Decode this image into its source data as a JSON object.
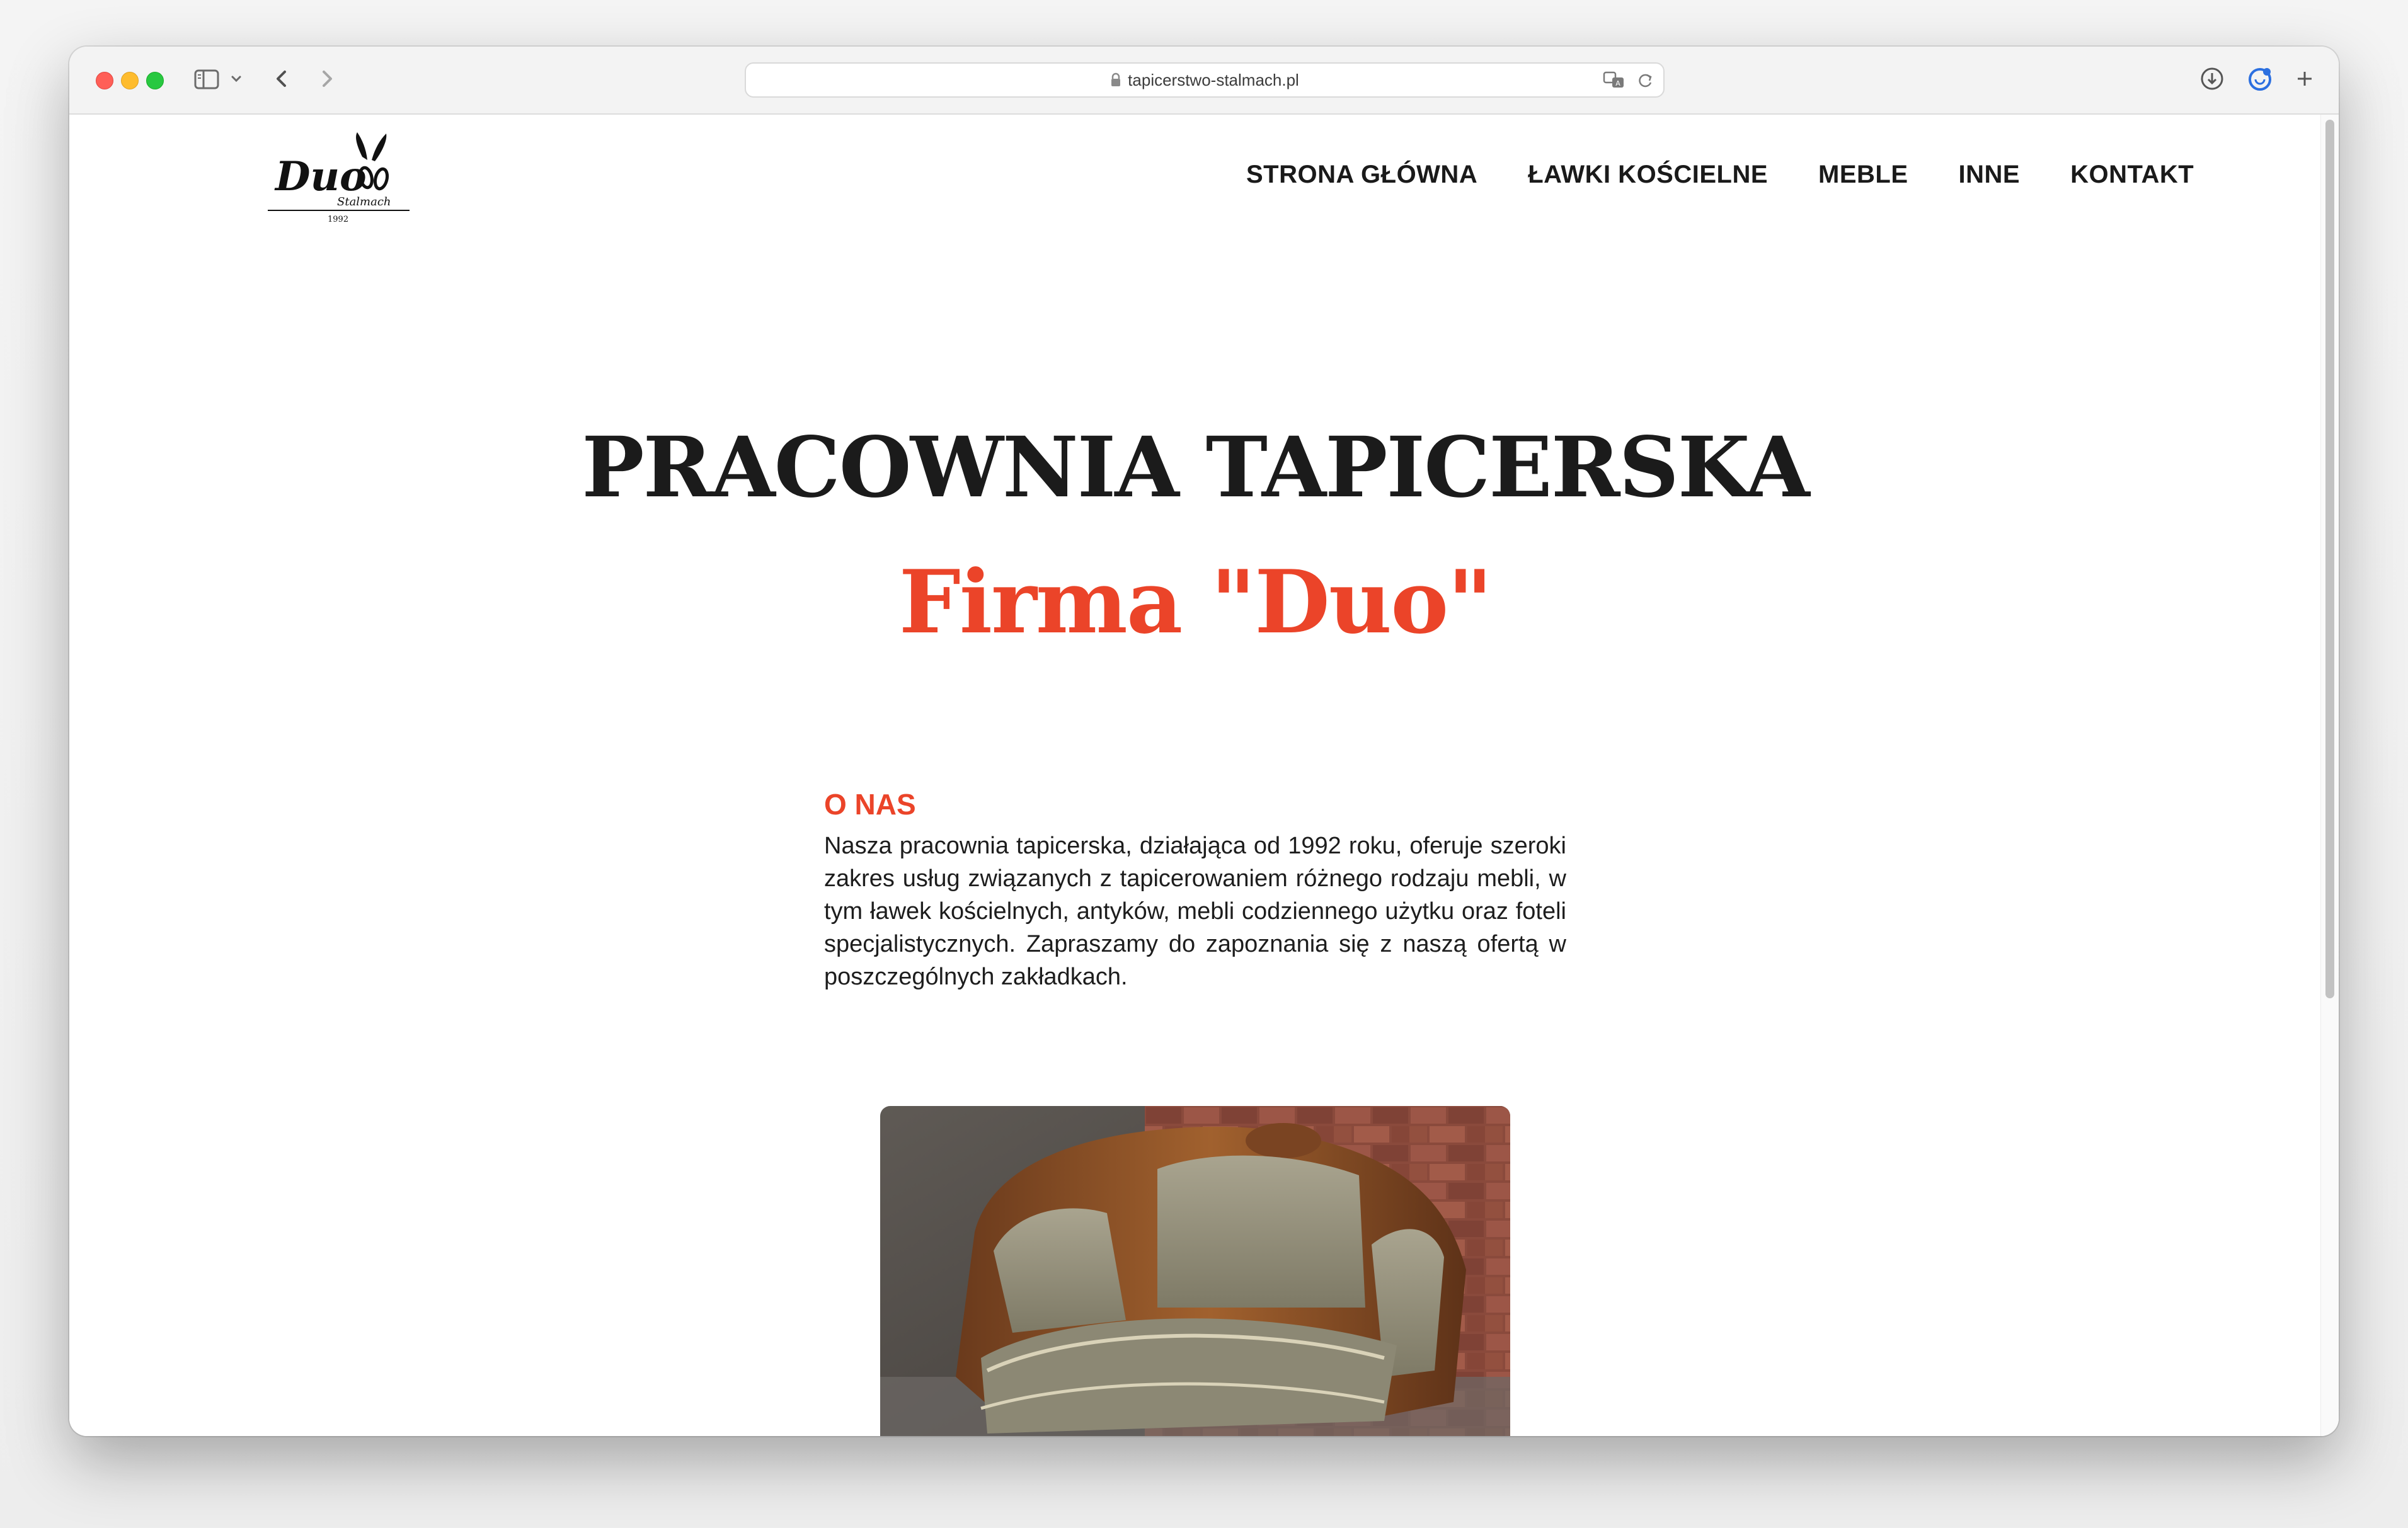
{
  "browser": {
    "url": "tapicerstwo-stalmach.pl"
  },
  "site": {
    "logo": {
      "wordmark": "Duo",
      "subtitle": "Stalmach",
      "year": "1992"
    },
    "nav": [
      {
        "label": "STRONA GŁÓWNA"
      },
      {
        "label": "ŁAWKI KOŚCIELNE"
      },
      {
        "label": "MEBLE"
      },
      {
        "label": "INNE"
      },
      {
        "label": "KONTAKT"
      }
    ],
    "hero": {
      "title": "PRACOWNIA TAPICERSKA",
      "subtitle": "Firma \"Duo\""
    },
    "about": {
      "heading": "O NAS",
      "text": "Nasza pracownia tapicerska, działająca od 1992 roku, oferuje szeroki zakres usług związanych z tapicerowaniem różnego rodzaju mebli, w tym ławek kościelnych, antyków, mebli codziennego użytku oraz foteli specjalistycznych. Zapraszamy do zapoznania się z naszą ofertą w poszczególnych zakładkach."
    }
  },
  "colors": {
    "accent": "#eb4429",
    "text": "#1b1b1b"
  }
}
